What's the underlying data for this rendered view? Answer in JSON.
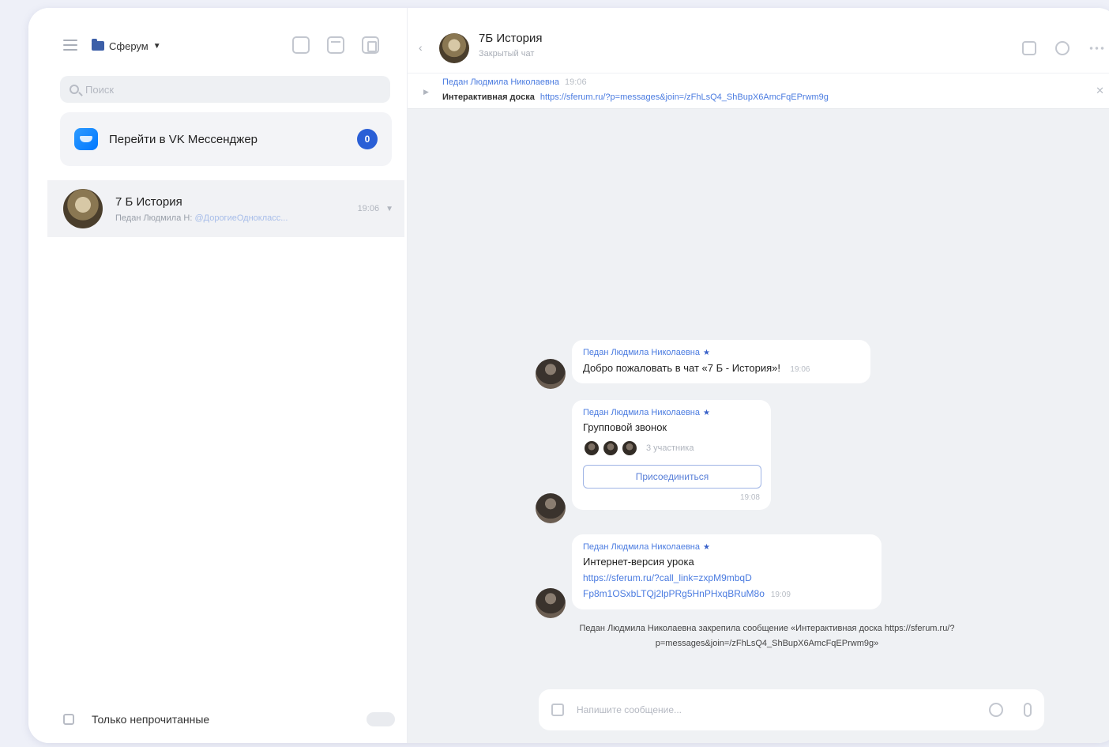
{
  "sidebar": {
    "folder_label": "Сферум",
    "search": {
      "placeholder": "Поиск"
    },
    "promo": {
      "label": "Перейти в VK Мессенджер",
      "badge": "0"
    },
    "chats": [
      {
        "title": "7 Б История",
        "snippet_author": "Педан Людмила Н",
        "snippet_text": "@ДорогиеОднокласс...",
        "time": "19:06"
      }
    ],
    "unread_only_label": "Только непрочитанные"
  },
  "chat": {
    "title": "7Б История",
    "subtitle": "Закрытый чат",
    "pinned": {
      "author": "Педан Людмила Николаевна",
      "time": "19:06",
      "label": "Интерактивная доска",
      "link": "https://sferum.ru/?p=messages&join=/zFhLsQ4_ShBupX6AmcFqEPrwm9g"
    },
    "messages": [
      {
        "author": "Педан Людмила Николаевна",
        "text": "Добро пожаловать в чат «7 Б - История»!",
        "time": "19:06"
      },
      {
        "author": "Педан Людмила Николаевна",
        "text": "Групповой звонок",
        "voters": "3 участника",
        "button": "Присоединиться",
        "time": "19:08"
      },
      {
        "author": "Педан Людмила Николаевна",
        "text": "Интернет-версия урока",
        "link1": "https://sferum.ru/?call_link=zxpM9mbqD",
        "link2": "Fp8m1OSxbLTQj2lpPRg5HnPHxqBRuM8o",
        "time": "19:09"
      }
    ],
    "system_note": "Педан Людмила Николаевна закрепила сообщение «Интерактивная доска https://sferum.ru/?p=messages&join=/zFhLsQ4_ShBupX6AmcFqEPrwm9g»",
    "composer_placeholder": "Напишите сообщение..."
  }
}
